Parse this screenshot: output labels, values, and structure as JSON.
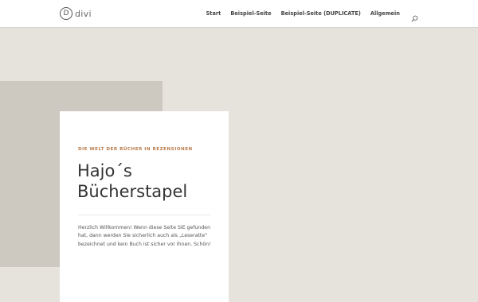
{
  "header": {
    "logo_mark": "D",
    "logo_text": "divi",
    "nav": [
      {
        "label": "Start"
      },
      {
        "label": "Beispiel-Seite"
      },
      {
        "label": "Beispiel-Seite (DUPLICATE)"
      },
      {
        "label": "Allgemein"
      }
    ],
    "search_icon": "search-icon"
  },
  "hero": {
    "eyebrow": "DIE WELT DER BÜCHER IN REZENSIONEN",
    "title_line1": "Hajo´s",
    "title_line2": "Bücherstapel",
    "intro": "Herzlich Willkommen! Wenn diese Seite SIE gefunden hat, dann werden Sie sicherlich auch als „Leseratte\" bezeichnet und kein Buch ist sicher vor Ihnen. Schön!"
  },
  "colors": {
    "page_bg": "#e6e2dc",
    "block_bg": "#cdc9c1",
    "card_bg": "#ffffff",
    "accent": "#b87a4b"
  }
}
